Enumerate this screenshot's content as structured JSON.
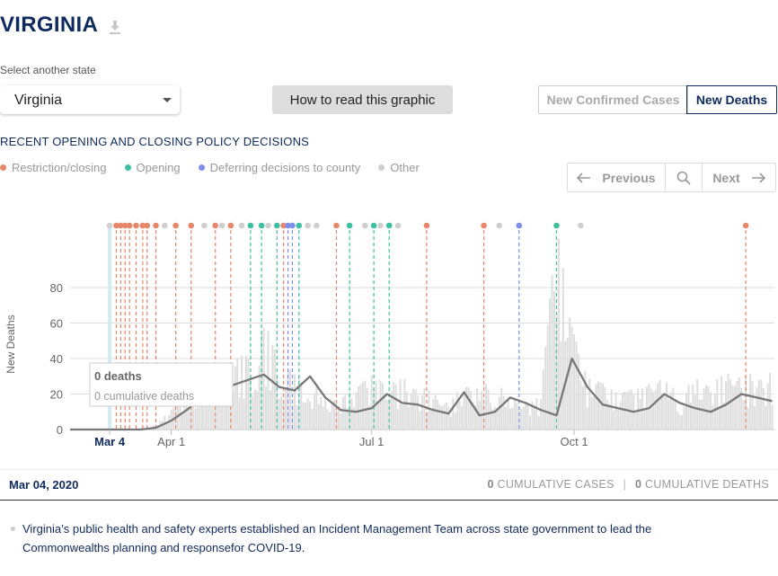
{
  "header": {
    "state_title": "VIRGINIA",
    "download_icon": "download-icon"
  },
  "selector": {
    "label": "Select another state",
    "value": "Virginia"
  },
  "how_to_button": "How to read this graphic",
  "metric_tabs": {
    "confirmed": "New Confirmed Cases",
    "deaths": "New Deaths",
    "active": "New Deaths"
  },
  "section_title": "RECENT OPENING AND CLOSING POLICY DECISIONS",
  "legend": [
    {
      "label": "Restriction/closing",
      "color": "#e8866a"
    },
    {
      "label": "Opening",
      "color": "#3dbfa0"
    },
    {
      "label": "Deferring decisions to county",
      "color": "#7f8ee8"
    },
    {
      "label": "Other",
      "color": "#cfcfcf"
    }
  ],
  "pager": {
    "previous": "Previous",
    "next": "Next",
    "search_icon": "search-icon"
  },
  "tooltip": {
    "deaths": "0 deaths",
    "cumulative": "0 cumulative deaths"
  },
  "footer": {
    "date": "Mar 04, 2020",
    "cases_value": "0",
    "cases_label": "CUMULATIVE CASES",
    "separator": "|",
    "deaths_value": "0",
    "deaths_label": "CUMULATIVE DEATHS"
  },
  "event_text": "Virginia’s public health and safety experts established an Incident Management Team across state government to lead the Commonwealths planning and responsefor COVID-19.",
  "chart_data": {
    "type": "bar",
    "x_axis": {
      "label": "",
      "tick_labels": [
        "Mar 4",
        "Apr 1",
        "Jul 1",
        "Oct 1"
      ],
      "start_date": "2020-02-15",
      "end_date": "2020-12-31"
    },
    "y_axis": {
      "label": "New Deaths",
      "ticks": [
        0,
        20,
        40,
        60,
        80
      ],
      "ylim": [
        0,
        90
      ]
    },
    "grid": true,
    "selected_date": "Mar 4",
    "series": [
      {
        "type": "bar",
        "name": "",
        "description": "daily new deaths (light gray bars), sampled weekly",
        "x": [
          "Mar 4",
          "Mar 11",
          "Mar 18",
          "Mar 25",
          "Apr 1",
          "Apr 8",
          "Apr 15",
          "Apr 22",
          "Apr 29",
          "May 6",
          "May 13",
          "May 20",
          "May 27",
          "Jun 3",
          "Jun 10",
          "Jun 17",
          "Jun 24",
          "Jul 1",
          "Jul 8",
          "Jul 15",
          "Jul 22",
          "Jul 29",
          "Aug 5",
          "Aug 12",
          "Aug 19",
          "Aug 26",
          "Sep 2",
          "Sep 9",
          "Sep 16",
          "Sep 23",
          "Sep 30",
          "Oct 7",
          "Oct 14",
          "Oct 21",
          "Oct 28",
          "Nov 4",
          "Nov 11",
          "Nov 18",
          "Nov 25",
          "Dec 2",
          "Dec 9",
          "Dec 16",
          "Dec 23",
          "Dec 30"
        ],
        "y": [
          0,
          0,
          0,
          2,
          8,
          12,
          22,
          26,
          28,
          30,
          42,
          30,
          22,
          20,
          12,
          14,
          16,
          22,
          18,
          20,
          18,
          14,
          10,
          18,
          16,
          20,
          12,
          10,
          14,
          80,
          40,
          20,
          18,
          14,
          16,
          18,
          20,
          14,
          20,
          18,
          22,
          20,
          24,
          22
        ]
      },
      {
        "type": "line",
        "name": "",
        "description": "7-day average of new deaths (dark gray line), sampled weekly",
        "x": [
          "Mar 4",
          "Mar 11",
          "Mar 18",
          "Mar 25",
          "Apr 1",
          "Apr 8",
          "Apr 15",
          "Apr 22",
          "Apr 29",
          "May 6",
          "May 13",
          "May 20",
          "May 27",
          "Jun 3",
          "Jun 10",
          "Jun 17",
          "Jun 24",
          "Jul 1",
          "Jul 8",
          "Jul 15",
          "Jul 22",
          "Jul 29",
          "Aug 5",
          "Aug 12",
          "Aug 19",
          "Aug 26",
          "Sep 2",
          "Sep 9",
          "Sep 16",
          "Sep 23",
          "Sep 30",
          "Oct 7",
          "Oct 14",
          "Oct 21",
          "Oct 28",
          "Nov 4",
          "Nov 11",
          "Nov 18",
          "Nov 25",
          "Dec 2",
          "Dec 9",
          "Dec 16",
          "Dec 23",
          "Dec 30"
        ],
        "y": [
          0,
          0,
          0,
          1,
          5,
          11,
          18,
          24,
          25,
          28,
          31,
          24,
          22,
          30,
          18,
          11,
          10,
          12,
          20,
          15,
          14,
          11,
          9,
          21,
          8,
          10,
          18,
          15,
          11,
          8,
          40,
          24,
          14,
          12,
          10,
          12,
          20,
          15,
          12,
          10,
          14,
          20,
          18,
          16
        ]
      }
    ],
    "policy_events": [
      {
        "date": "2020-03-04",
        "category": "Other"
      },
      {
        "date": "2020-03-07",
        "category": "Restriction/closing"
      },
      {
        "date": "2020-03-09",
        "category": "Restriction/closing"
      },
      {
        "date": "2020-03-11",
        "category": "Restriction/closing"
      },
      {
        "date": "2020-03-13",
        "category": "Restriction/closing"
      },
      {
        "date": "2020-03-16",
        "category": "Restriction/closing"
      },
      {
        "date": "2020-03-19",
        "category": "Restriction/closing"
      },
      {
        "date": "2020-03-21",
        "category": "Restriction/closing"
      },
      {
        "date": "2020-03-25",
        "category": "Restriction/closing"
      },
      {
        "date": "2020-03-29",
        "category": "Other"
      },
      {
        "date": "2020-04-03",
        "category": "Restriction/closing"
      },
      {
        "date": "2020-04-10",
        "category": "Restriction/closing"
      },
      {
        "date": "2020-04-16",
        "category": "Other"
      },
      {
        "date": "2020-04-21",
        "category": "Restriction/closing"
      },
      {
        "date": "2020-04-24",
        "category": "Other"
      },
      {
        "date": "2020-04-28",
        "category": "Restriction/closing"
      },
      {
        "date": "2020-05-03",
        "category": "Other"
      },
      {
        "date": "2020-05-07",
        "category": "Opening"
      },
      {
        "date": "2020-05-12",
        "category": "Opening"
      },
      {
        "date": "2020-05-15",
        "category": "Other"
      },
      {
        "date": "2020-05-19",
        "category": "Opening"
      },
      {
        "date": "2020-05-22",
        "category": "Restriction/closing"
      },
      {
        "date": "2020-05-24",
        "category": "Deferring decisions to county"
      },
      {
        "date": "2020-05-26",
        "category": "Deferring decisions to county"
      },
      {
        "date": "2020-05-29",
        "category": "Opening"
      },
      {
        "date": "2020-06-02",
        "category": "Other"
      },
      {
        "date": "2020-06-06",
        "category": "Other"
      },
      {
        "date": "2020-06-15",
        "category": "Restriction/closing"
      },
      {
        "date": "2020-06-21",
        "category": "Opening"
      },
      {
        "date": "2020-06-28",
        "category": "Other"
      },
      {
        "date": "2020-07-02",
        "category": "Opening"
      },
      {
        "date": "2020-07-05",
        "category": "Other"
      },
      {
        "date": "2020-07-09",
        "category": "Opening"
      },
      {
        "date": "2020-07-13",
        "category": "Other"
      },
      {
        "date": "2020-07-26",
        "category": "Restriction/closing"
      },
      {
        "date": "2020-08-21",
        "category": "Restriction/closing"
      },
      {
        "date": "2020-08-28",
        "category": "Other"
      },
      {
        "date": "2020-09-06",
        "category": "Deferring decisions to county"
      },
      {
        "date": "2020-09-23",
        "category": "Opening"
      },
      {
        "date": "2020-10-04",
        "category": "Other"
      },
      {
        "date": "2020-12-18",
        "category": "Restriction/closing"
      }
    ]
  }
}
